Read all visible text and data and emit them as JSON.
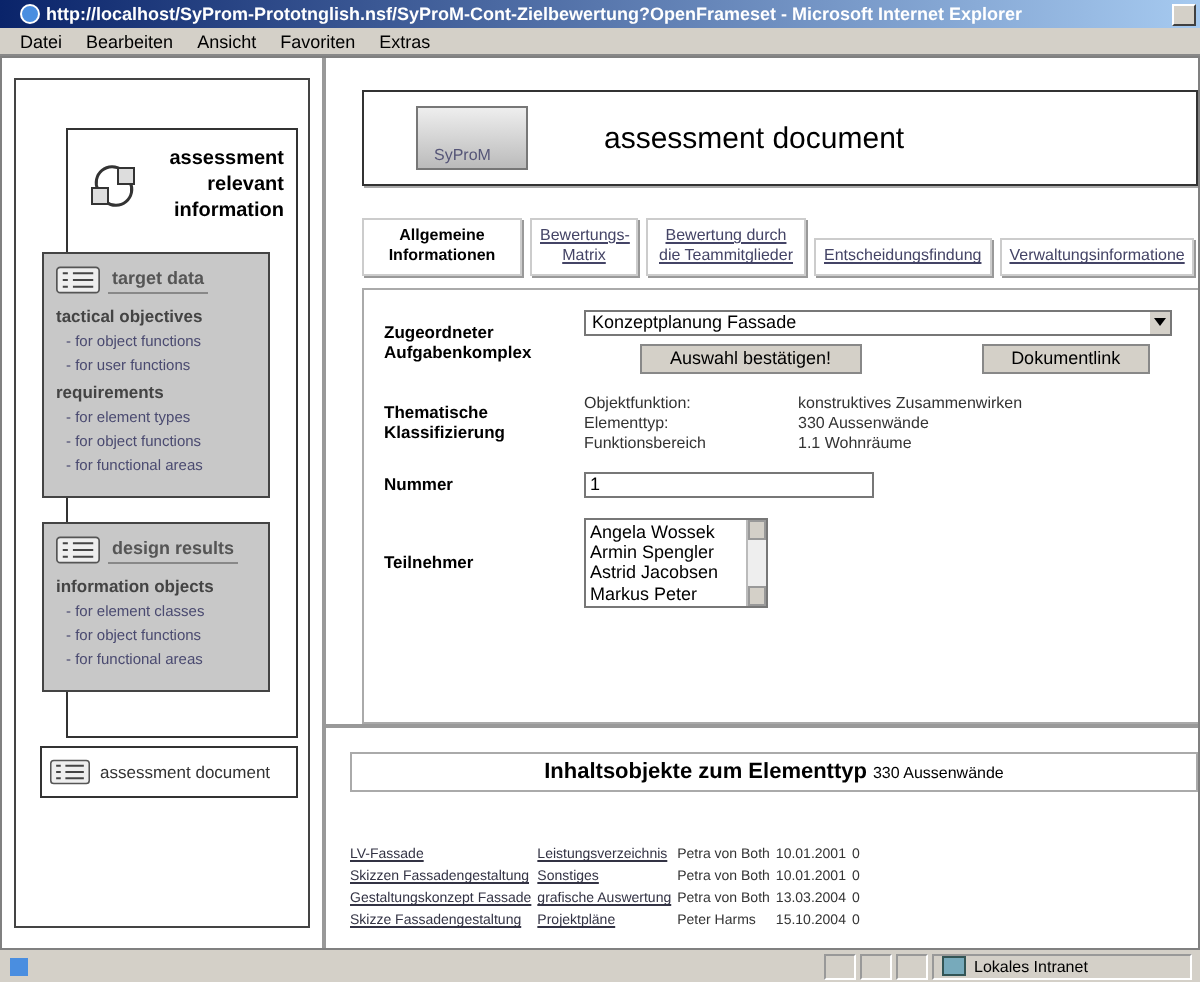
{
  "window": {
    "title": "http://localhost/SyProm-Prototnglish.nsf/SyProM-Cont-Zielbewertung?OpenFrameset - Microsoft Internet Explorer"
  },
  "menu": [
    "Datei",
    "Bearbeiten",
    "Ansicht",
    "Favoriten",
    "Extras"
  ],
  "sidebar": {
    "header": [
      "assessment",
      "relevant",
      "information"
    ],
    "cards": [
      {
        "title": "target data",
        "groups": [
          {
            "heading": "tactical objectives",
            "items": [
              "- for object functions",
              "- for user functions"
            ]
          },
          {
            "heading": "requirements",
            "items": [
              "- for element types",
              "- for object functions",
              "- for functional areas"
            ]
          }
        ]
      },
      {
        "title": "design results",
        "groups": [
          {
            "heading": "information objects",
            "items": [
              "- for element classes",
              "- for object functions",
              "- for functional areas"
            ]
          }
        ]
      }
    ],
    "document_link": "assessment document"
  },
  "header": {
    "logo": "SyProM",
    "title": "assessment document"
  },
  "tabs": [
    {
      "label": "Allgemeine Informationen",
      "selected": true
    },
    {
      "label": "Bewertungs-Matrix",
      "selected": false
    },
    {
      "label": "Bewertung durch die Teammitglieder",
      "selected": false
    },
    {
      "label": "Entscheidungsfindung",
      "selected": false
    },
    {
      "label": "Verwaltungsinformatione",
      "selected": false
    }
  ],
  "form": {
    "task_label": "Zugeordneter Aufgabenkomplex",
    "task_value": "Konzeptplanung Fassade",
    "buttons": [
      "Auswahl bestätigen!",
      "Dokumentlink"
    ],
    "class_label": "Thematische Klassifizierung",
    "classification": [
      {
        "key": "Objektfunktion:",
        "value": "konstruktives Zusammenwirken"
      },
      {
        "key": "Elementtyp:",
        "value": "330 Aussenwände"
      },
      {
        "key": "Funktionsbereich",
        "value": "1.1 Wohnräume"
      }
    ],
    "number_label": "Nummer",
    "number_value": "1",
    "participants_label": "Teilnehmer",
    "participants": [
      "Angela Wossek",
      "Armin Spengler",
      "Astrid Jacobsen",
      "Markus Peter"
    ]
  },
  "objects": {
    "heading": "Inhaltsobjekte zum Elementtyp",
    "heading_value": "330 Aussenwände",
    "rows": [
      {
        "name": "LV-Fassade",
        "type": "Leistungsverzeichnis",
        "person": "Petra von Both",
        "date": "10.01.2001",
        "count": "0"
      },
      {
        "name": "Skizzen Fassadengestaltung",
        "type": "Sonstiges",
        "person": "Petra von Both",
        "date": "10.01.2001",
        "count": "0"
      },
      {
        "name": "Gestaltungskonzept Fassade",
        "type": "grafische Auswertung",
        "person": "Petra von Both",
        "date": "13.03.2004",
        "count": "0"
      },
      {
        "name": "Skizze Fassadengestaltung",
        "type": "Projektpläne",
        "person": "Peter Harms",
        "date": "15.10.2004",
        "count": "0"
      }
    ]
  },
  "status_bar": {
    "zone": "Lokales Intranet"
  }
}
